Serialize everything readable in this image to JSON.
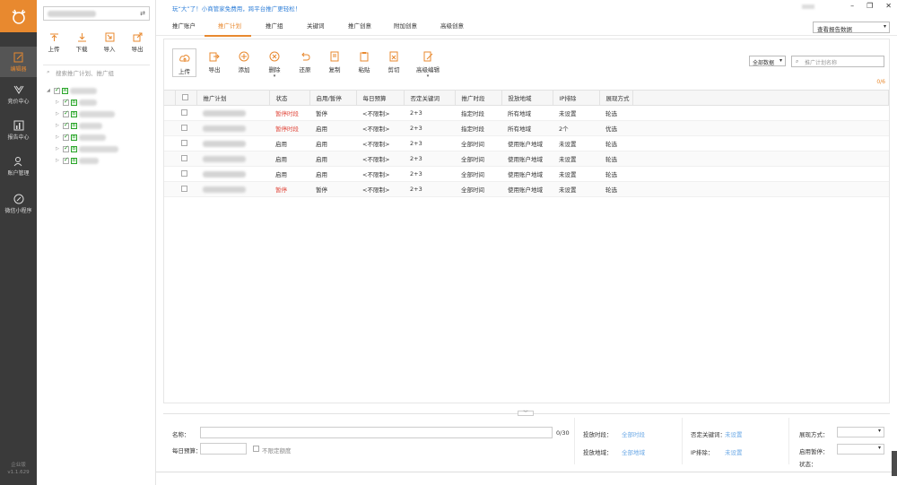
{
  "rail": {
    "items": [
      {
        "label": "编辑器",
        "icon": "edit-icon",
        "active": true
      },
      {
        "label": "竞价中心",
        "icon": "bid-icon",
        "active": false
      },
      {
        "label": "报告中心",
        "icon": "chart-icon",
        "active": false
      },
      {
        "label": "账户管理",
        "icon": "user-icon",
        "active": false
      },
      {
        "label": "微信小程序",
        "icon": "link-icon",
        "active": false
      }
    ],
    "version_line1": "企业版",
    "version_line2": "v1.1.629",
    "accent": "#e8892f"
  },
  "panel": {
    "tools": [
      {
        "label": "上传",
        "icon": "upload-arrow-icon"
      },
      {
        "label": "下载",
        "icon": "download-arrow-icon"
      },
      {
        "label": "导入",
        "icon": "import-icon"
      },
      {
        "label": "导出",
        "icon": "export-icon"
      }
    ],
    "search_placeholder": "搜索推广计划、推广组"
  },
  "header": {
    "notice": "玩“大”了！小商管家免费用，跨平台推广更轻松！",
    "tabs": [
      "推广账户",
      "推广计划",
      "推广组",
      "关键词",
      "推广创意",
      "附加创意",
      "高级创意"
    ],
    "active_tab": "推广计划",
    "report_select": "查看报告数据"
  },
  "toolbar": {
    "buttons": [
      {
        "label": "上传",
        "icon": "cloud-upload-icon"
      },
      {
        "label": "导出",
        "icon": "export-icon"
      },
      {
        "label": "添加",
        "icon": "plus-circle-icon"
      },
      {
        "label": "删除",
        "icon": "delete-circle-icon"
      },
      {
        "label": "还原",
        "icon": "undo-icon"
      },
      {
        "label": "复制",
        "icon": "copy-icon"
      },
      {
        "label": "粘贴",
        "icon": "paste-icon"
      },
      {
        "label": "剪切",
        "icon": "cut-icon"
      },
      {
        "label": "高级编辑",
        "icon": "advanced-edit-icon"
      }
    ],
    "data_filter": "全部数据",
    "plan_search_placeholder": "推广计划名称",
    "count": "0/6"
  },
  "table": {
    "columns": [
      "推广计划",
      "状态",
      "启用/暂停",
      "每日预算",
      "否定关键词",
      "推广时段",
      "投放地域",
      "IP排除",
      "展现方式"
    ],
    "rows": [
      {
        "status": "暂停时段",
        "status_red": true,
        "toggle": "暂停",
        "budget": "<不限制>",
        "neg": "2+3",
        "time": "指定时段",
        "region": "所有地域",
        "ip": "未设置",
        "show": "轮选"
      },
      {
        "status": "暂停时段",
        "status_red": true,
        "toggle": "启用",
        "budget": "<不限制>",
        "neg": "2+3",
        "time": "指定时段",
        "region": "所有地域",
        "ip": "2个",
        "show": "优选"
      },
      {
        "status": "启用",
        "status_red": false,
        "toggle": "启用",
        "budget": "<不限制>",
        "neg": "2+3",
        "time": "全部时间",
        "region": "使用账户地域",
        "ip": "未设置",
        "show": "轮选"
      },
      {
        "status": "启用",
        "status_red": false,
        "toggle": "启用",
        "budget": "<不限制>",
        "neg": "2+3",
        "time": "全部时间",
        "region": "使用账户地域",
        "ip": "未设置",
        "show": "轮选"
      },
      {
        "status": "启用",
        "status_red": false,
        "toggle": "启用",
        "budget": "<不限制>",
        "neg": "2+3",
        "time": "全部时间",
        "region": "使用账户地域",
        "ip": "未设置",
        "show": "轮选"
      },
      {
        "status": "暂停",
        "status_red": true,
        "toggle": "暂停",
        "budget": "<不限制>",
        "neg": "2+3",
        "time": "全部时间",
        "region": "使用账户地域",
        "ip": "未设置",
        "show": "轮选"
      }
    ]
  },
  "editor": {
    "name_label": "名称：",
    "name_counter": "0/30",
    "budget_label": "每日预算：",
    "unlimited_label": "不限定额度",
    "time_label": "投放时段：",
    "time_value": "全部时段",
    "region_label": "投放地域：",
    "region_value": "全部地域",
    "neg_label": "否定关键词：",
    "neg_value": "未设置",
    "ip_label": "IP排除：",
    "ip_value": "未设置",
    "show_label": "展现方式：",
    "toggle_label": "启用暂停：",
    "state_label": "状态："
  }
}
